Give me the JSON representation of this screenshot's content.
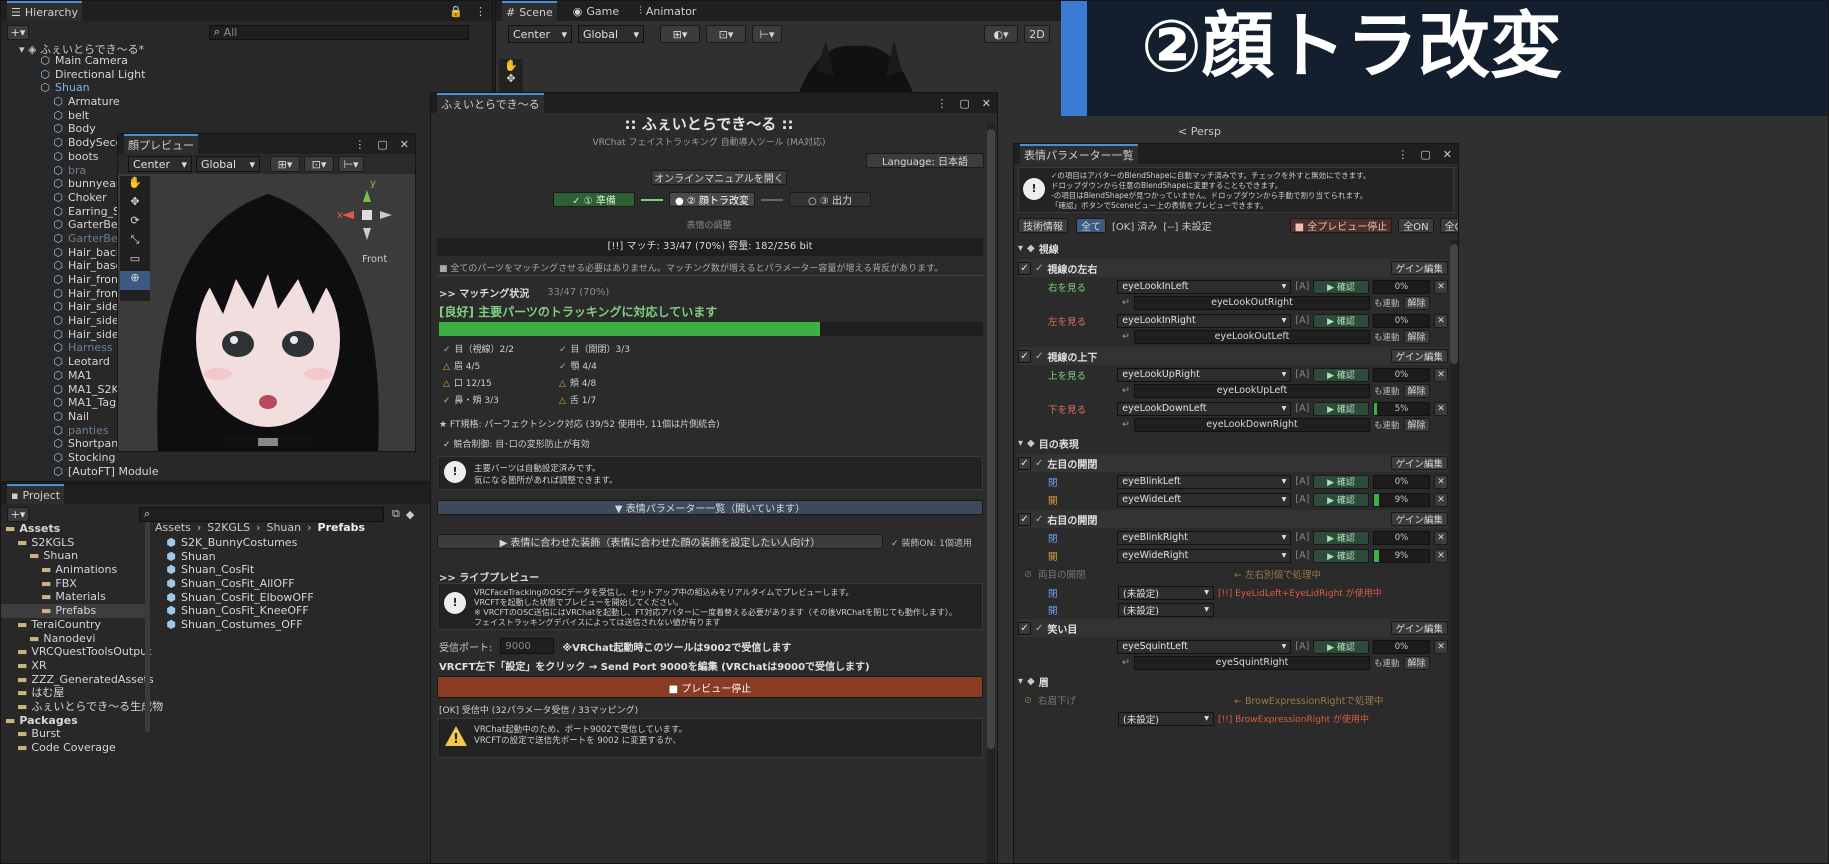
{
  "hierarchy": {
    "tab": "Hierarchy",
    "search_placeholder": "All",
    "scene": "ふぇいとらでき〜る*",
    "items": [
      {
        "label": "Main Camera",
        "indent": 2,
        "dim": false
      },
      {
        "label": "Directional Light",
        "indent": 2,
        "dim": false
      },
      {
        "label": "Shuan",
        "indent": 2,
        "dim": false,
        "selected": true
      },
      {
        "label": "Armature",
        "indent": 3,
        "dim": false
      },
      {
        "label": "belt",
        "indent": 3,
        "dim": false
      },
      {
        "label": "Body",
        "indent": 3,
        "dim": false
      },
      {
        "label": "BodySeco",
        "indent": 3,
        "dim": false
      },
      {
        "label": "boots",
        "indent": 3,
        "dim": false
      },
      {
        "label": "bra",
        "indent": 3,
        "dim": true
      },
      {
        "label": "bunnyear",
        "indent": 3,
        "dim": false
      },
      {
        "label": "Choker",
        "indent": 3,
        "dim": false
      },
      {
        "label": "Earring_S",
        "indent": 3,
        "dim": false
      },
      {
        "label": "GarterBelt",
        "indent": 3,
        "dim": false
      },
      {
        "label": "GarterBelt",
        "indent": 3,
        "dim": true
      },
      {
        "label": "Hair_back",
        "indent": 3,
        "dim": false
      },
      {
        "label": "Hair_base",
        "indent": 3,
        "dim": false
      },
      {
        "label": "Hair_front",
        "indent": 3,
        "dim": false
      },
      {
        "label": "Hair_front",
        "indent": 3,
        "dim": false
      },
      {
        "label": "Hair_side",
        "indent": 3,
        "dim": false
      },
      {
        "label": "Hair_sideb",
        "indent": 3,
        "dim": false
      },
      {
        "label": "Hair_sideb",
        "indent": 3,
        "dim": false
      },
      {
        "label": "Harness",
        "indent": 3,
        "dim": true
      },
      {
        "label": "Leotard",
        "indent": 3,
        "dim": false
      },
      {
        "label": "MA1",
        "indent": 3,
        "dim": false
      },
      {
        "label": "MA1_S2KI",
        "indent": 3,
        "dim": false
      },
      {
        "label": "MA1_Tag",
        "indent": 3,
        "dim": false
      },
      {
        "label": "Nail",
        "indent": 3,
        "dim": false
      },
      {
        "label": "panties",
        "indent": 3,
        "dim": true
      },
      {
        "label": "Shortpants",
        "indent": 3,
        "dim": false
      },
      {
        "label": "Stocking",
        "indent": 3,
        "dim": false
      },
      {
        "label": "[AutoFT] Module",
        "indent": 3,
        "dim": false
      }
    ]
  },
  "scene_tabs": {
    "scene": "Scene",
    "game": "Game",
    "animator": "Animator",
    "center": "Center",
    "global": "Global",
    "mode2d": "2D",
    "persp": "< Persp"
  },
  "face_preview": {
    "title": "顔プレビュー",
    "center": "Center",
    "global": "Global",
    "front": "Front",
    "axis_x": "x",
    "axis_y": "y"
  },
  "project": {
    "tab": "Project",
    "breadcrumb": [
      "Assets",
      "S2KGLS",
      "Shuan",
      "Prefabs"
    ],
    "tree": [
      {
        "label": "Assets",
        "indent": 0,
        "bold": true
      },
      {
        "label": "S2KGLS",
        "indent": 1
      },
      {
        "label": "Shuan",
        "indent": 2
      },
      {
        "label": "Animations",
        "indent": 3
      },
      {
        "label": "FBX",
        "indent": 3
      },
      {
        "label": "Materials",
        "indent": 3
      },
      {
        "label": "Prefabs",
        "indent": 3,
        "selected": true
      },
      {
        "label": "TeraiCountry",
        "indent": 1
      },
      {
        "label": "Nanodevi",
        "indent": 2
      },
      {
        "label": "VRCQuestToolsOutput",
        "indent": 1
      },
      {
        "label": "XR",
        "indent": 1
      },
      {
        "label": "ZZZ_GeneratedAssets",
        "indent": 1
      },
      {
        "label": "はむ屋",
        "indent": 1
      },
      {
        "label": "ふぇいとらでき〜る生成物",
        "indent": 1
      },
      {
        "label": "Packages",
        "indent": 0,
        "bold": true
      },
      {
        "label": "Burst",
        "indent": 1
      },
      {
        "label": "Code Coverage",
        "indent": 1
      }
    ],
    "files": [
      "S2K_BunnyCostumes",
      "Shuan",
      "Shuan_CosFit",
      "Shuan_CosFit_AllOFF",
      "Shuan_CosFit_ElbowOFF",
      "Shuan_CosFit_KneeOFF",
      "Shuan_Costumes_OFF"
    ]
  },
  "tool": {
    "tab": "ふぇいとらでき〜る",
    "title": ":: ふぇいとらでき〜る ::",
    "subtitle": "VRChat フェイストラッキング 自動導入ツール (MA対応)",
    "language": "Language: 日本語",
    "manual_button": "オンラインマニュアルを開く",
    "steps": [
      "✓ ① 準備",
      "● ② 顔トラ改変",
      "○ ③ 出力"
    ],
    "step_caption": "表情の調整",
    "match_bar": "[!!] マッチ: 33/47 (70%)     容量: 182/256 bit",
    "note": "■ 全てのパーツをマッチングさせる必要はありません。マッチング数が増えるとパラメーター容量が増える背反があります。",
    "matching_header": ">> マッチング状況",
    "matching_count": "33/47 (70%)",
    "good_message": "[良好] 主要パーツのトラッキングに対応しています",
    "progress": 0.7,
    "parts": [
      {
        "mark": "✓",
        "label": "目（視線）2/2",
        "ok": true
      },
      {
        "mark": "✓",
        "label": "目（開閉）3/3",
        "ok": true
      },
      {
        "mark": "△",
        "label": "眉 4/5",
        "ok": false
      },
      {
        "mark": "✓",
        "label": "顎 4/4",
        "ok": true
      },
      {
        "mark": "△",
        "label": "口 12/15",
        "ok": false
      },
      {
        "mark": "△",
        "label": "頬 4/8",
        "ok": false
      },
      {
        "mark": "✓",
        "label": "鼻・頬 3/3",
        "ok": true
      },
      {
        "mark": "△",
        "label": "舌 1/7",
        "ok": false
      }
    ],
    "ft_spec": "★ FT規格: パーフェクトシンク対応 (39/52 使用中, 11個は片側統合)",
    "conflict": "✓ 競合制御: 目･口の変形防止が有効",
    "info_lines": [
      "主要パーツは自動設定済みです。",
      "気になる箇所があれば調整できます。"
    ],
    "expr_list_button": "▼ 表情パラメーター一覧（開いています）",
    "accessory_button": "▶ 表情に合わせた装飾（表情に合わせた顔の装飾を設定したい人向け）",
    "accessory_status": "✓ 装飾ON: 1個適用",
    "live_header": ">> ライブプレビュー",
    "live_info": [
      "VRCFaceTrackingのOSCデータを受信し、セットアップ中の組込みをリアルタイムでプレビューします。",
      "VRCFTを起動した状態でプレビューを開始してください。",
      "※ VRCFTのOSC送信にはVRChatを起動し、FT対応アバターに一度着替える必要があります（その後VRChatを閉じても動作します）。",
      "フェイストラッキングデバイスによっては送信されない値が有ります"
    ],
    "port_label": "受信ポート:",
    "port_value": "9000",
    "port_note": "※VRChat起動時このツールは9002で受信します",
    "vrcft_note": "VRCFT左下「設定」をクリック → Send Port 9000を編集 (VRChatは9000で受信します)",
    "stop_button": "■ プレビュー停止",
    "receiving": "[OK] 受信中 (32パラメータ受信 / 33マッピング)",
    "warn_lines": [
      "VRChat起動中のため、ポート9002で受信しています。",
      "VRCFTの設定で送信先ポートを 9002 に変更するか、"
    ]
  },
  "expr": {
    "tab": "表情パラメーター一覧",
    "info_lines": [
      "✓の項目はアバターのBlendShapeに自動マッチ済みです。チェックを外すと無効にできます。",
      "ドロップダウンから任意のBlendShapeに変更することもできます。",
      "-の項目はBlendShapeが見つかっていません。ドロップダウンから手動で割り当てられます。",
      "「確認」ボタンでSceneビュー上の表情をプレビューできます。"
    ],
    "tech": "技術情報",
    "filter_all": "全て",
    "filter_ok": "[OK] 済み",
    "filter_unset": "[--] 未設定",
    "stop_all": "■ 全プレビュー停止",
    "all_on": "全ON",
    "all_off": "全OFF",
    "confirm": "▶ 確認",
    "gain": "ゲイン編集",
    "link": "も連動",
    "unlink": "解除",
    "a_tag": "[A]",
    "sec_gaze": "視線",
    "gaze_lr": "視線の左右",
    "look_right": "右を見る",
    "eyeLookInLeft": "eyeLookInLeft",
    "eyeLookOutRight": "eyeLookOutRight",
    "look_left": "左を見る",
    "eyeLookInRight": "eyeLookInRight",
    "eyeLookOutLeft": "eyeLookOutLeft",
    "gaze_ud": "視線の上下",
    "look_up": "上を見る",
    "eyeLookUpRight": "eyeLookUpRight",
    "eyeLookUpLeft": "eyeLookUpLeft",
    "look_down": "下を見る",
    "eyeLookDownLeft": "eyeLookDownLeft",
    "eyeLookDownRight": "eyeLookDownRight",
    "sec_eye": "目の表現",
    "left_eye": "左目の開閉",
    "close": "閉",
    "open": "開",
    "eyeBlinkLeft": "eyeBlinkLeft",
    "eyeWideLeft": "eyeWideLeft",
    "right_eye": "右目の開閉",
    "eyeBlinkRight": "eyeBlinkRight",
    "eyeWideRight": "eyeWideRight",
    "both_eyes": "両目の開閉",
    "both_note": "← 左右別個で処理中",
    "unset": "(未設定)",
    "both_warn": "[!!] EyeLidLeft+EyeLidRight が使用中",
    "smile_eye": "笑い目",
    "eyeSquintLeft": "eyeSquintLeft",
    "eyeSquintRight": "eyeSquintRight",
    "sec_brow": "眉",
    "brow_down": "右眉下げ",
    "brow_note": "← BrowExpressionRightで処理中",
    "brow_warn": "[!!] BrowExpressionRight が使用中",
    "v0": "0%",
    "v1": "0%",
    "v2": "0%",
    "v3": "5%",
    "v4": "0%",
    "v5": "9%",
    "v6": "0%",
    "v7": "9%",
    "v8": "0%"
  },
  "overlay": {
    "text": "②顔トラ改変",
    "accent": "#3a7bd5"
  }
}
